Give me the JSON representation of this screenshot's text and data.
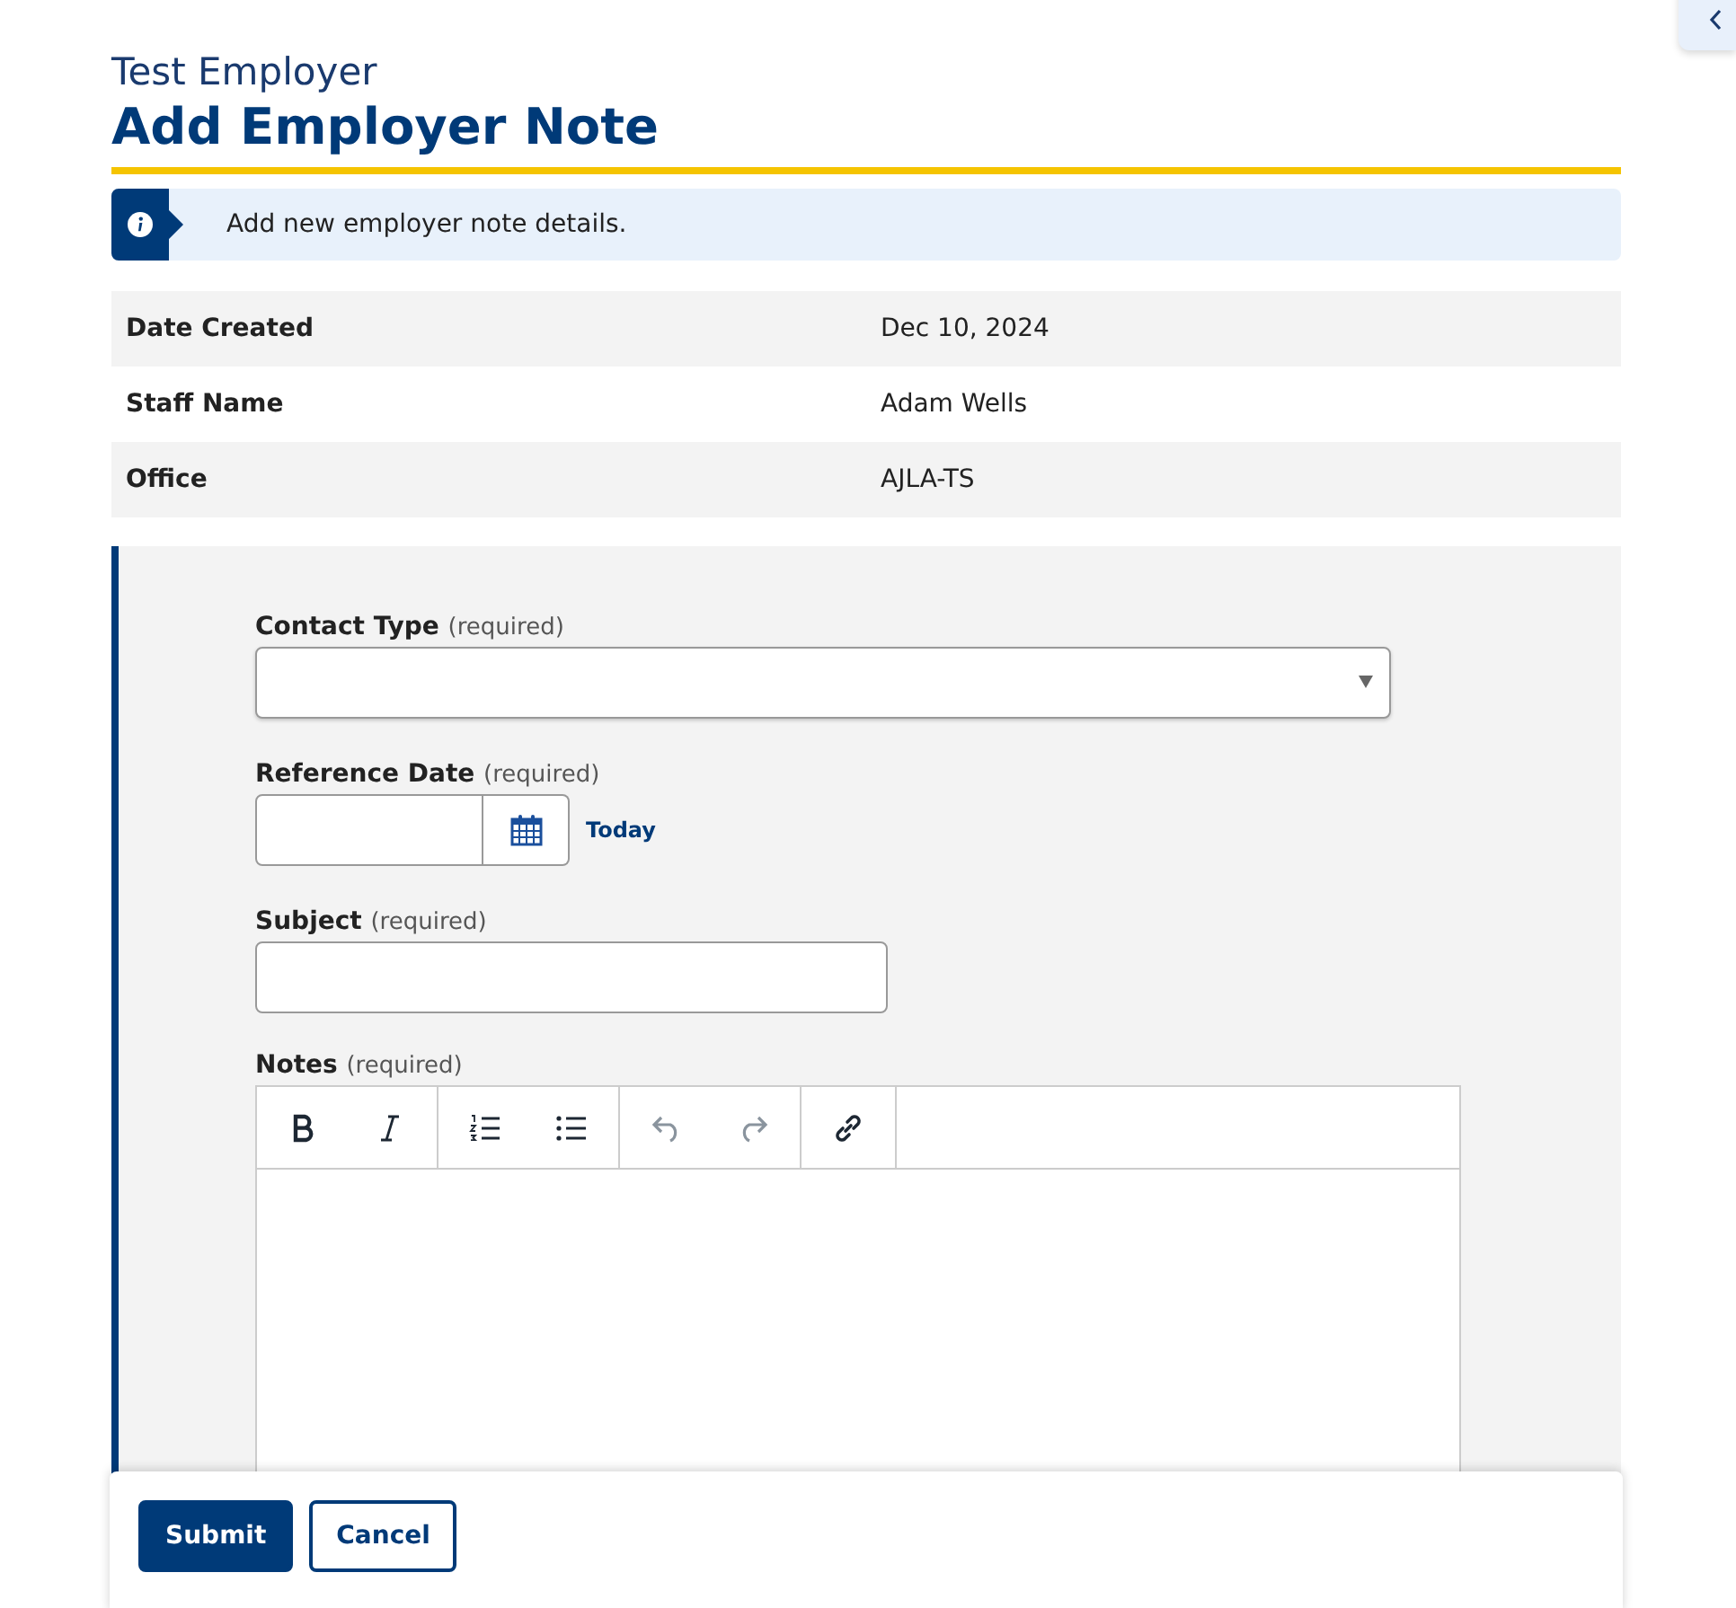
{
  "header": {
    "subtitle": "Test Employer",
    "title": "Add Employer Note"
  },
  "info": {
    "text": "Add new employer note details."
  },
  "details": [
    {
      "label": "Date Created",
      "value": "Dec 10, 2024"
    },
    {
      "label": "Staff Name",
      "value": "Adam Wells"
    },
    {
      "label": "Office",
      "value": "AJLA-TS"
    }
  ],
  "form": {
    "contact_type": {
      "label": "Contact Type",
      "hint": "(required)"
    },
    "reference_date": {
      "label": "Reference Date",
      "hint": "(required)",
      "today_link": "Today"
    },
    "subject": {
      "label": "Subject",
      "hint": "(required)"
    },
    "notes": {
      "label": "Notes",
      "hint": "(required)",
      "toolbar": [
        [
          {
            "kind": "bold",
            "disabled": false
          },
          {
            "kind": "italic",
            "disabled": false
          }
        ],
        [
          {
            "kind": "ordered-list",
            "disabled": false
          },
          {
            "kind": "bullet-list",
            "disabled": false
          }
        ],
        [
          {
            "kind": "undo",
            "disabled": true
          },
          {
            "kind": "redo",
            "disabled": true
          }
        ],
        [
          {
            "kind": "link",
            "disabled": false
          }
        ]
      ]
    }
  },
  "footer": {
    "buttons": [
      {
        "label": "Submit",
        "kind": "primary"
      },
      {
        "label": "Cancel",
        "kind": "secondary"
      }
    ]
  }
}
